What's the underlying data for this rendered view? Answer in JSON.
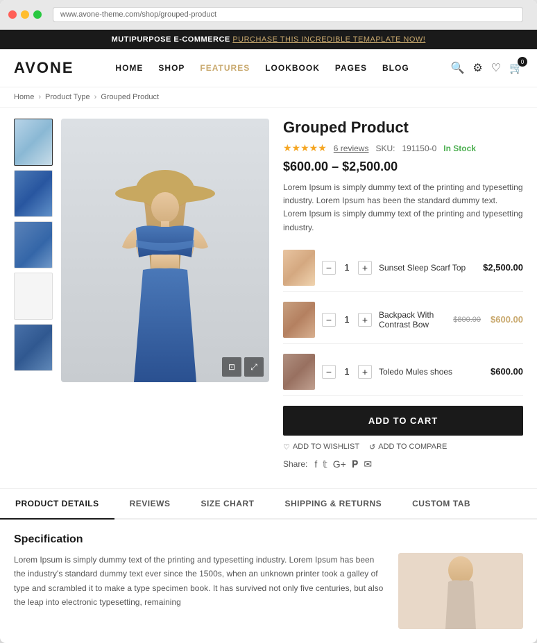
{
  "browser": {
    "address": "www.avone-theme.com/shop/grouped-product"
  },
  "announcement": {
    "prefix": "MUTIPURPOSE E-COMMERCE",
    "link_text": "PURCHASE THIS INCREDIBLE TEMAPLATE NOW!"
  },
  "header": {
    "logo": "AVONE",
    "nav": [
      {
        "label": "HOME",
        "active": false
      },
      {
        "label": "SHOP",
        "active": false
      },
      {
        "label": "FEATURES",
        "active": true
      },
      {
        "label": "LOOKBOOK",
        "active": false
      },
      {
        "label": "PAGES",
        "active": false
      },
      {
        "label": "BLOG",
        "active": false
      }
    ],
    "cart_count": "0"
  },
  "breadcrumb": {
    "items": [
      "Home",
      "Product Type",
      "Grouped Product"
    ]
  },
  "product": {
    "title": "Grouped Product",
    "rating": "★★★★★",
    "reviews": "6 reviews",
    "sku_label": "SKU:",
    "sku": "191150-0",
    "stock": "In Stock",
    "price": "$600.00 – $2,500.00",
    "description": "Lorem Ipsum is simply dummy text of the printing and typesetting industry. Lorem Ipsum has been the standard dummy text. Lorem Ipsum is simply dummy text of the printing and typesetting industry.",
    "items": [
      {
        "name": "Sunset Sleep Scarf Top",
        "price": "$2,500.00",
        "old_price": null,
        "sale_price": null,
        "qty": "1"
      },
      {
        "name": "Backpack With Contrast Bow",
        "price": null,
        "old_price": "$800.00",
        "sale_price": "$600.00",
        "qty": "1"
      },
      {
        "name": "Toledo Mules shoes",
        "price": "$600.00",
        "old_price": null,
        "sale_price": null,
        "qty": "1"
      }
    ],
    "add_to_cart": "ADD TO CART",
    "add_to_wishlist": "ADD TO WISHLIST",
    "add_to_compare": "ADD TO COMPARE",
    "share_label": "Share:"
  },
  "tabs": [
    {
      "label": "PRODUCT DETAILS",
      "active": true
    },
    {
      "label": "REVIEWS",
      "active": false
    },
    {
      "label": "SIZE CHART",
      "active": false
    },
    {
      "label": "SHIPPING & RETURNS",
      "active": false
    },
    {
      "label": "CUSTOM TAB",
      "active": false
    }
  ],
  "specification": {
    "title": "Specification",
    "text1": "Lorem Ipsum is simply dummy text of the printing and typesetting industry. Lorem Ipsum has been the industry's standard dummy text ever since the 1500s, when an unknown printer took a galley of type and scrambled it to make a type specimen book. It has survived not only five centuries, but also the leap into electronic typesetting, remaining"
  }
}
